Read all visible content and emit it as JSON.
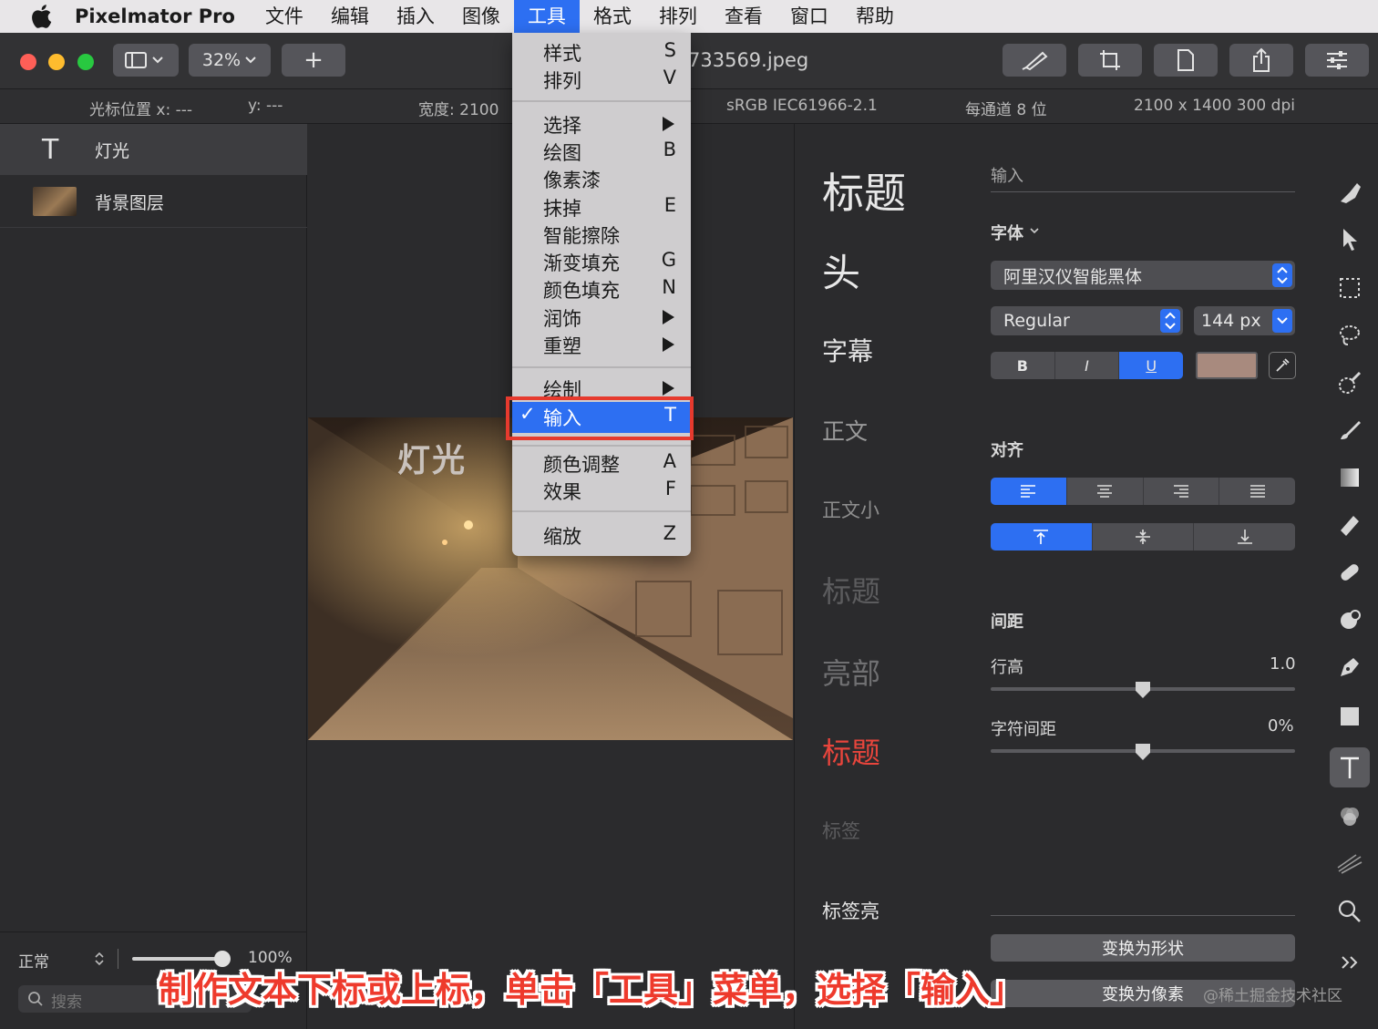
{
  "menubar": {
    "app_name": "Pixelmator Pro",
    "items": [
      "文件",
      "编辑",
      "插入",
      "图像",
      "工具",
      "格式",
      "排列",
      "查看",
      "窗口",
      "帮助"
    ],
    "active_item": "工具"
  },
  "toolbar": {
    "zoom": "32%",
    "add_label": "+",
    "doc_title": "733569.jpeg"
  },
  "infobar": {
    "cursor_x": "光标位置 x:  ---",
    "cursor_y": "y:  ---",
    "width": "宽度:  2100",
    "color_profile": "sRGB IEC61966-2.1",
    "bit_depth": "每通道 8 位",
    "dimensions": "2100 x 1400 300 dpi"
  },
  "layers": {
    "items": [
      {
        "name": "灯光",
        "type": "text-layer",
        "selected": true
      },
      {
        "name": "背景图层",
        "type": "image-layer",
        "selected": false
      }
    ],
    "blend_mode": "正常",
    "opacity": "100%",
    "search_placeholder": "搜索"
  },
  "canvas": {
    "overlay_text": "灯光"
  },
  "styles": {
    "items": [
      "标题",
      "头",
      "字幕",
      "正文",
      "正文小",
      "标题",
      "亮部",
      "标题",
      "标签",
      "标签亮"
    ]
  },
  "inspector": {
    "input_label": "输入",
    "font_label": "字体",
    "font_family": "阿里汉仪智能黑体",
    "font_weight": "Regular",
    "font_size": "144 px",
    "bold": "B",
    "italic": "I",
    "underline": "U",
    "text_color": "#a88a7e",
    "align_label": "对齐",
    "spacing_label": "间距",
    "line_height_label": "行高",
    "line_height_value": "1.0",
    "letter_spacing_label": "字符间距",
    "letter_spacing_value": "0%",
    "convert_shape": "变换为形状",
    "convert_pixels": "变换为像素"
  },
  "dropdown": {
    "items": [
      {
        "label": "样式",
        "key": "S"
      },
      {
        "label": "排列",
        "key": "V"
      },
      {
        "label": "选择",
        "key": "▶"
      },
      {
        "label": "绘图",
        "key": "B"
      },
      {
        "label": "像素漆",
        "key": ""
      },
      {
        "label": "抹掉",
        "key": "E"
      },
      {
        "label": "智能擦除",
        "key": ""
      },
      {
        "label": "渐变填充",
        "key": "G"
      },
      {
        "label": "颜色填充",
        "key": "N"
      },
      {
        "label": "润饰",
        "key": "▶"
      },
      {
        "label": "重塑",
        "key": "▶"
      },
      {
        "label": "绘制",
        "key": "▶"
      },
      {
        "label": "输入",
        "key": "T"
      },
      {
        "label": "颜色调整",
        "key": "A"
      },
      {
        "label": "效果",
        "key": "F"
      },
      {
        "label": "缩放",
        "key": "Z"
      }
    ],
    "checkmark": "✓"
  },
  "caption": "制作文本下标或上标，单击「工具」菜单，选择「输入」",
  "watermark": "@稀土掘金技术社区",
  "colors": {
    "accent": "#2d6ff2",
    "highlight_red": "#e63a2e",
    "caption_red": "#ee3a2c"
  }
}
